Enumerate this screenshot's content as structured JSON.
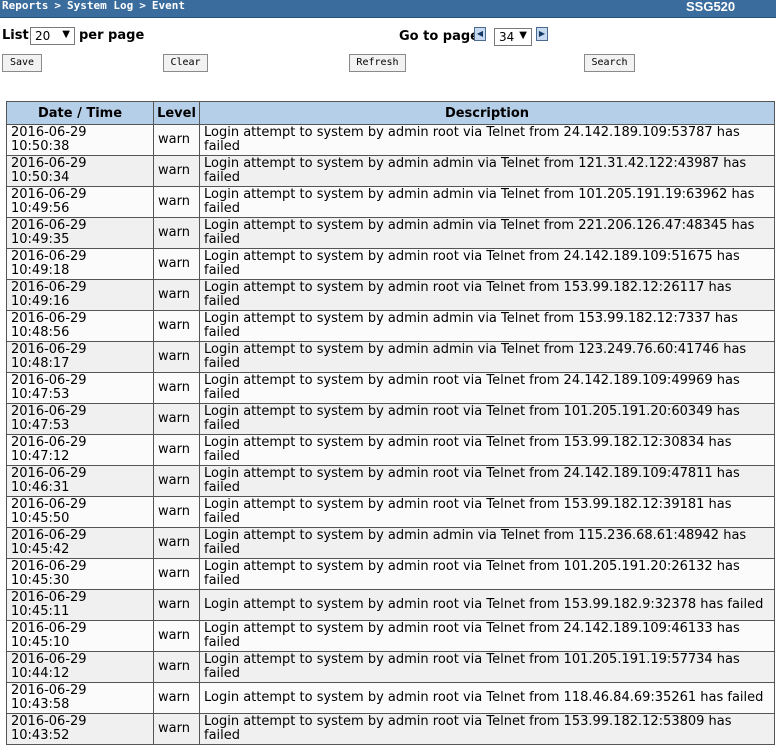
{
  "header": {
    "breadcrumbs": [
      "Reports",
      "System Log",
      "Event"
    ],
    "breadcrumb_separator": ">",
    "device_name": "SSG520"
  },
  "toolbar": {
    "list_label": "List",
    "per_page_value": "20",
    "per_page_label": "per page",
    "goto_label": "Go to page",
    "page_value": "34",
    "save_label": "Save",
    "clear_label": "Clear",
    "refresh_label": "Refresh",
    "search_label": "Search"
  },
  "table": {
    "columns": [
      "Date / Time",
      "Level",
      "Description"
    ],
    "rows": [
      {
        "datetime": "2016-06-29 10:50:38",
        "level": "warn",
        "description": "Login attempt to system by admin root via Telnet from 24.142.189.109:53787 has failed"
      },
      {
        "datetime": "2016-06-29 10:50:34",
        "level": "warn",
        "description": "Login attempt to system by admin admin via Telnet from 121.31.42.122:43987 has failed"
      },
      {
        "datetime": "2016-06-29 10:49:56",
        "level": "warn",
        "description": "Login attempt to system by admin admin via Telnet from 101.205.191.19:63962 has failed"
      },
      {
        "datetime": "2016-06-29 10:49:35",
        "level": "warn",
        "description": "Login attempt to system by admin admin via Telnet from 221.206.126.47:48345 has failed"
      },
      {
        "datetime": "2016-06-29 10:49:18",
        "level": "warn",
        "description": "Login attempt to system by admin root via Telnet from 24.142.189.109:51675 has failed"
      },
      {
        "datetime": "2016-06-29 10:49:16",
        "level": "warn",
        "description": "Login attempt to system by admin root via Telnet from 153.99.182.12:26117 has failed"
      },
      {
        "datetime": "2016-06-29 10:48:56",
        "level": "warn",
        "description": "Login attempt to system by admin admin via Telnet from 153.99.182.12:7337 has failed"
      },
      {
        "datetime": "2016-06-29 10:48:17",
        "level": "warn",
        "description": "Login attempt to system by admin admin via Telnet from 123.249.76.60:41746 has failed"
      },
      {
        "datetime": "2016-06-29 10:47:53",
        "level": "warn",
        "description": "Login attempt to system by admin root via Telnet from 24.142.189.109:49969 has failed"
      },
      {
        "datetime": "2016-06-29 10:47:53",
        "level": "warn",
        "description": "Login attempt to system by admin root via Telnet from 101.205.191.20:60349 has failed"
      },
      {
        "datetime": "2016-06-29 10:47:12",
        "level": "warn",
        "description": "Login attempt to system by admin root via Telnet from 153.99.182.12:30834 has failed"
      },
      {
        "datetime": "2016-06-29 10:46:31",
        "level": "warn",
        "description": "Login attempt to system by admin root via Telnet from 24.142.189.109:47811 has failed"
      },
      {
        "datetime": "2016-06-29 10:45:50",
        "level": "warn",
        "description": "Login attempt to system by admin root via Telnet from 153.99.182.12:39181 has failed"
      },
      {
        "datetime": "2016-06-29 10:45:42",
        "level": "warn",
        "description": "Login attempt to system by admin admin via Telnet from 115.236.68.61:48942 has failed"
      },
      {
        "datetime": "2016-06-29 10:45:30",
        "level": "warn",
        "description": "Login attempt to system by admin root via Telnet from 101.205.191.20:26132 has failed"
      },
      {
        "datetime": "2016-06-29 10:45:11",
        "level": "warn",
        "description": "Login attempt to system by admin root via Telnet from 153.99.182.9:32378 has failed"
      },
      {
        "datetime": "2016-06-29 10:45:10",
        "level": "warn",
        "description": "Login attempt to system by admin root via Telnet from 24.142.189.109:46133 has failed"
      },
      {
        "datetime": "2016-06-29 10:44:12",
        "level": "warn",
        "description": "Login attempt to system by admin root via Telnet from 101.205.191.19:57734 has failed"
      },
      {
        "datetime": "2016-06-29 10:43:58",
        "level": "warn",
        "description": "Login attempt to system by admin root via Telnet from 118.46.84.69:35261 has failed"
      },
      {
        "datetime": "2016-06-29 10:43:52",
        "level": "warn",
        "description": "Login attempt to system by admin root via Telnet from 153.99.182.12:53809 has failed"
      }
    ]
  }
}
